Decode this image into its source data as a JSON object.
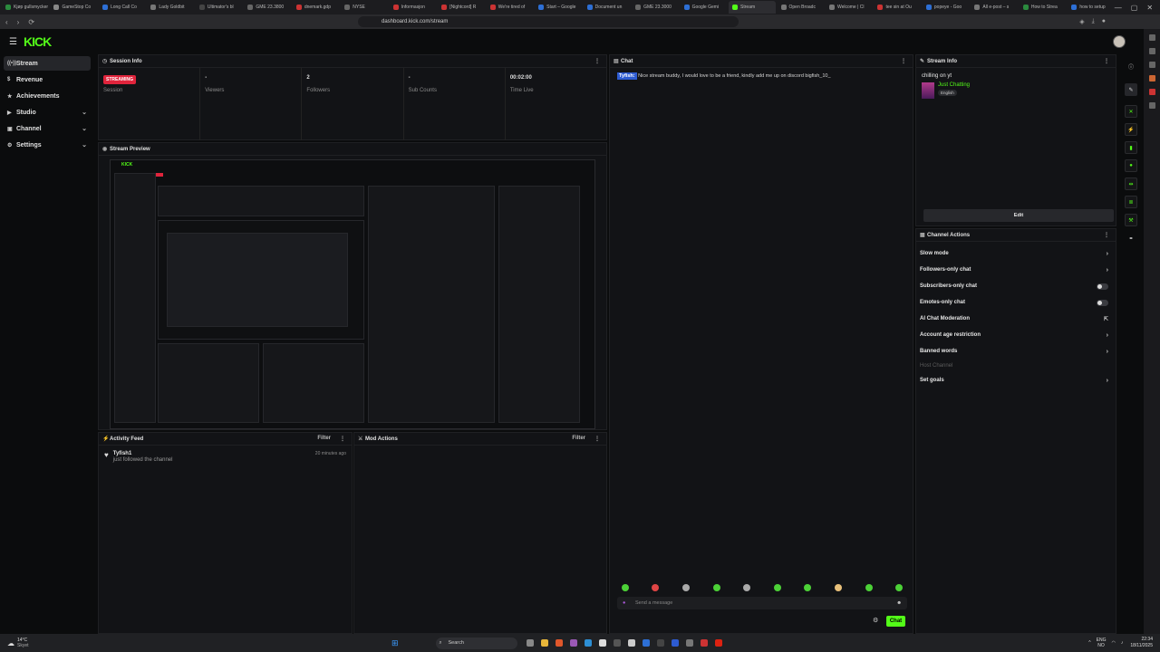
{
  "browser": {
    "tabs": [
      "Kjøp gullsmycker",
      "GameStop Co",
      "Long Call Co",
      "Lady Goldbit",
      "Ultimator's bl",
      "GME 23.3800",
      "dnemark.gdp",
      "NYSE",
      "Informasjon",
      "[Nightcord] R",
      "We're tired of",
      "Start – Google",
      "Document un",
      "GME 23.3000",
      "Google Gemi",
      "Stream",
      "Open Broadc",
      "Welcome | Cl",
      "tee sin at Ou",
      "popeye - Goo",
      "All e-post – s",
      "How to Strea",
      "how to setup"
    ],
    "active_tab_index": 15,
    "url": "dashboard.kick.com/stream",
    "window_controls": [
      "—",
      "▢",
      "✕"
    ]
  },
  "app": {
    "logo": "KICK",
    "accent": "#53fc18"
  },
  "sidebar": {
    "items": [
      {
        "label": "Stream",
        "icon": "broadcast-icon",
        "active": true,
        "expandable": false
      },
      {
        "label": "Revenue",
        "icon": "dollar-icon",
        "active": false,
        "expandable": false
      },
      {
        "label": "Achievements",
        "icon": "trophy-icon",
        "active": false,
        "expandable": false
      },
      {
        "label": "Studio",
        "icon": "play-icon",
        "active": false,
        "expandable": true
      },
      {
        "label": "Channel",
        "icon": "tv-icon",
        "active": false,
        "expandable": true
      },
      {
        "label": "Settings",
        "icon": "gear-icon",
        "active": false,
        "expandable": true
      }
    ]
  },
  "session": {
    "title": "Session Info",
    "status_badge": "STREAMING",
    "stats": [
      {
        "value": "",
        "label": "Session"
      },
      {
        "value": "-",
        "label": "Viewers"
      },
      {
        "value": "2",
        "label": "Followers"
      },
      {
        "value": "-",
        "label": "Sub Counts"
      },
      {
        "value": "00:02:00",
        "label": "Time Live"
      }
    ]
  },
  "preview": {
    "title": "Stream Preview"
  },
  "activity": {
    "title": "Activity Feed",
    "filter": "Filter",
    "events": [
      {
        "user": "Tyfish1",
        "action": "just followed the channel",
        "time": "20 minutes ago"
      }
    ]
  },
  "mod": {
    "title": "Mod Actions",
    "filter": "Filter"
  },
  "chat": {
    "title": "Chat",
    "messages": [
      {
        "user": "Tyfish:",
        "text": "Nice stream buddy, I would love to be a friend, kindly add me up on discord bigfish_10_"
      }
    ],
    "placeholder": "Send a message",
    "send_label": "Chat"
  },
  "stream_info": {
    "title": "Stream Info",
    "stream_title": "chilling on yt",
    "category": "Just Chatting",
    "language": "English",
    "edit_label": "Edit"
  },
  "channel_actions": {
    "title": "Channel Actions",
    "items": [
      {
        "label": "Slow mode",
        "control": "chevron"
      },
      {
        "label": "Followers-only chat",
        "control": "chevron"
      },
      {
        "label": "Subscribers-only chat",
        "control": "toggle"
      },
      {
        "label": "Emotes-only chat",
        "control": "toggle"
      },
      {
        "label": "AI Chat Moderation",
        "control": "external"
      },
      {
        "label": "Account age restriction",
        "control": "chevron"
      },
      {
        "label": "Banned words",
        "control": "chevron"
      },
      {
        "label": "Host Channel",
        "control": "disabled"
      },
      {
        "label": "Set goals",
        "control": "chevron"
      }
    ]
  },
  "taskbar": {
    "weather_temp": "14°C",
    "weather_desc": "Skyet",
    "search_placeholder": "Search",
    "lang": "ENG",
    "lang_sub": "NO",
    "time": "22:34",
    "date": "18/11/2025"
  }
}
